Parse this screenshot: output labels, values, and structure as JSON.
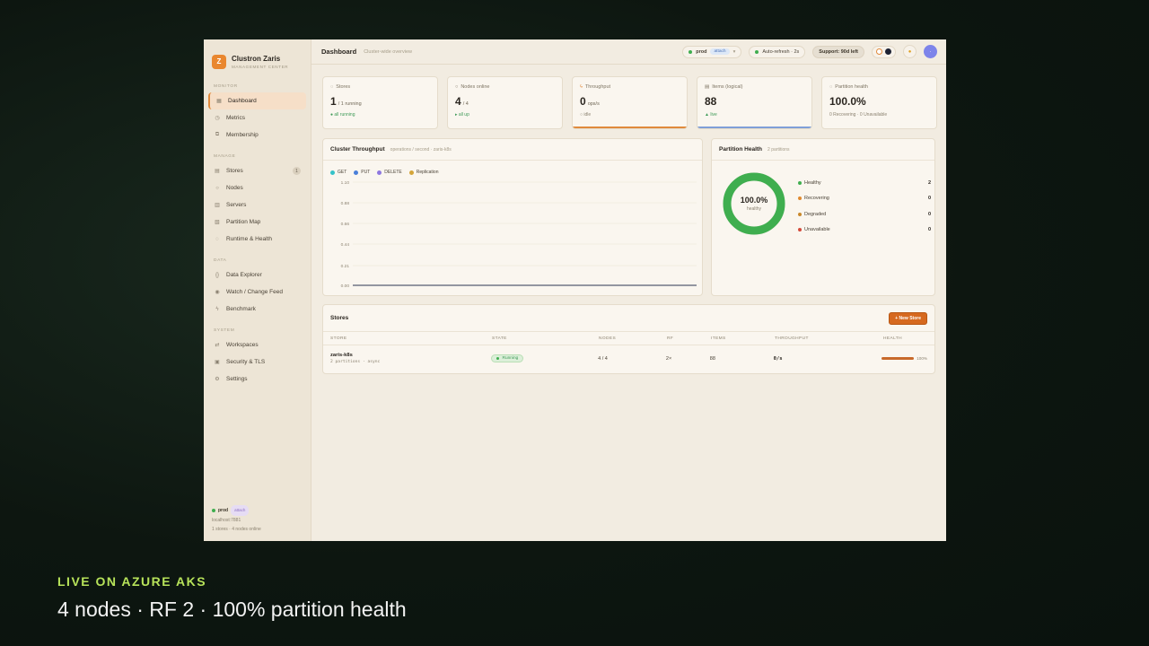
{
  "brand": {
    "name": "Clustron Zaris",
    "subtitle": "MANAGEMENT CENTER",
    "logo_letter": "Z"
  },
  "sidebar": {
    "sections": [
      {
        "title": "MONITOR",
        "items": [
          {
            "label": "Dashboard",
            "icon": "grid-icon",
            "active": true
          },
          {
            "label": "Metrics",
            "icon": "clock-icon"
          },
          {
            "label": "Membership",
            "icon": "users-icon"
          }
        ]
      },
      {
        "title": "MANAGE",
        "items": [
          {
            "label": "Stores",
            "icon": "database-icon",
            "badge": "1"
          },
          {
            "label": "Nodes",
            "icon": "node-icon"
          },
          {
            "label": "Servers",
            "icon": "server-icon"
          },
          {
            "label": "Partition Map",
            "icon": "map-icon"
          },
          {
            "label": "Runtime & Health",
            "icon": "heart-icon"
          }
        ]
      },
      {
        "title": "DATA",
        "items": [
          {
            "label": "Data Explorer",
            "icon": "braces-icon"
          },
          {
            "label": "Watch / Change Feed",
            "icon": "eye-icon"
          },
          {
            "label": "Benchmark",
            "icon": "bolt-icon"
          }
        ]
      },
      {
        "title": "SYSTEM",
        "items": [
          {
            "label": "Workspaces",
            "icon": "swap-icon"
          },
          {
            "label": "Security & TLS",
            "icon": "lock-icon"
          },
          {
            "label": "Settings",
            "icon": "gear-icon"
          }
        ]
      }
    ],
    "footer": {
      "env": "prod",
      "attach": "attach",
      "host": "localhost:7881",
      "summary": "1 stores · 4 nodes online"
    }
  },
  "topbar": {
    "title": "Dashboard",
    "subtitle": "Cluster-wide overview",
    "env": "prod",
    "env_tag": "attach",
    "autorefresh": "Auto-refresh · 2s",
    "support": "Support: 90d left"
  },
  "kpis": [
    {
      "label": "Stores",
      "value": "1",
      "suffix": "/ 1 running",
      "foot": "● all running",
      "foot_style": "green",
      "bar": ""
    },
    {
      "label": "Nodes online",
      "value": "4",
      "suffix": "/ 4",
      "foot": "▸ all up",
      "foot_style": "green",
      "bar": ""
    },
    {
      "label": "Throughput",
      "value": "0",
      "suffix": "ops/s",
      "foot": "○ idle",
      "foot_style": "grey",
      "bar": "#e08a3c"
    },
    {
      "label": "Items (logical)",
      "value": "88",
      "suffix": "",
      "foot": "▲ live",
      "foot_style": "green",
      "bar": "#7f9fd8"
    },
    {
      "label": "Partition health",
      "value": "100.0%",
      "suffix": "",
      "foot": "0 Recovering · 0 Unavailable",
      "foot_style": "grey",
      "bar": ""
    }
  ],
  "throughput_panel": {
    "title": "Cluster Throughput",
    "subtitle": "operations / second · zaris-k8s",
    "legend": [
      {
        "name": "GET",
        "color": "#35c2c9"
      },
      {
        "name": "PUT",
        "color": "#4a7fd9"
      },
      {
        "name": "DELETE",
        "color": "#8e77e0"
      },
      {
        "name": "Replication",
        "color": "#d4a53a"
      }
    ]
  },
  "chart_data": {
    "type": "line",
    "title": "Cluster Throughput",
    "yticks": [
      "1.10",
      "0.88",
      "0.66",
      "0.44",
      "0.21",
      "0.00"
    ],
    "ylim": [
      0,
      1.1
    ],
    "series": [
      {
        "name": "GET",
        "values": [
          0,
          0
        ]
      },
      {
        "name": "PUT",
        "values": [
          0,
          0
        ]
      },
      {
        "name": "DELETE",
        "values": [
          0,
          0
        ]
      },
      {
        "name": "Replication",
        "values": [
          0,
          0
        ]
      }
    ],
    "grid": true,
    "legend": "top-left"
  },
  "health_panel": {
    "title": "Partition Health",
    "subtitle": "2 partitions",
    "center_value": "100.0%",
    "center_label": "healthy",
    "healthy_fraction": 1.0,
    "rows": [
      {
        "label": "Healthy",
        "value": "2",
        "color": "#3fae4f"
      },
      {
        "label": "Recovering",
        "value": "0",
        "color": "#e0892e"
      },
      {
        "label": "Degraded",
        "value": "0",
        "color": "#c9882a"
      },
      {
        "label": "Unavailable",
        "value": "0",
        "color": "#d44a3a"
      }
    ]
  },
  "stores": {
    "title": "Stores",
    "new_button": "+ New Store",
    "columns": [
      "STORE",
      "STATE",
      "NODES",
      "RF",
      "ITEMS",
      "THROUGHPUT",
      "HEALTH"
    ],
    "rows": [
      {
        "name": "zaris-k8s",
        "sub": "2 partitions · async",
        "state": "Running",
        "nodes": "4 / 4",
        "rf": "2×",
        "items": "88",
        "throughput": "0/s",
        "health": "100%",
        "health_fraction": 1.0
      }
    ]
  },
  "caption": {
    "kicker": "LIVE ON AZURE AKS",
    "main": "4 nodes · RF 2 · 100% partition health"
  }
}
